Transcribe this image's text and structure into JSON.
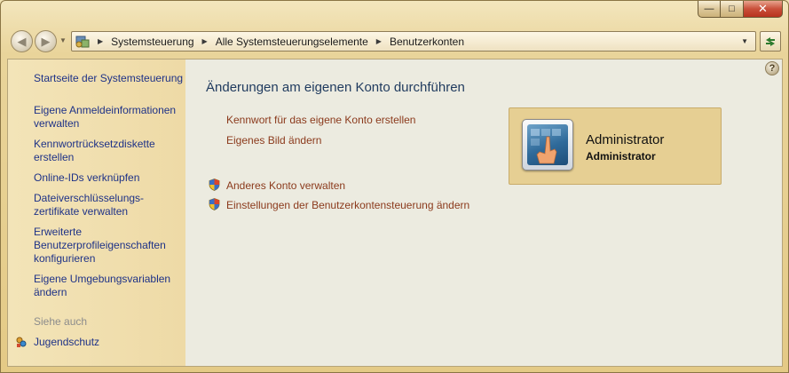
{
  "breadcrumb": [
    "Systemsteuerung",
    "Alle Systemsteuerungselemente",
    "Benutzerkonten"
  ],
  "sidebar": {
    "home_link": "Startseite der Systemsteuerung",
    "links": [
      {
        "line1": "Eigene Anmeldeinformationen",
        "line2": "verwalten"
      },
      {
        "line1": "Kennwortrücksetzdiskette",
        "line2": "erstellen"
      },
      {
        "line1": "Online-IDs verknüpfen",
        "line2": ""
      },
      {
        "line1": "Dateiverschlüsselungs-",
        "line2": "zertifikate verwalten"
      },
      {
        "line1": "Erweiterte",
        "line2": "Benutzerprofileigenschaften",
        "line3": "konfigurieren"
      },
      {
        "line1": "Eigene Umgebungsvariablen",
        "line2": "ändern"
      }
    ],
    "see_also_heading": "Siehe auch",
    "see_also_items": [
      "Jugendschutz"
    ]
  },
  "main": {
    "title": "Änderungen am eigenen Konto durchführen",
    "tasks": [
      "Kennwort für das eigene Konto erstellen",
      "Eigenes Bild ändern"
    ],
    "admin_tasks": [
      "Anderes Konto verwalten",
      "Einstellungen der Benutzerkontensteuerung ändern"
    ]
  },
  "account": {
    "name": "Administrator",
    "role": "Administrator"
  },
  "colors": {
    "link_blue": "#1e3287",
    "task_link": "#8b3a1c",
    "sidebar_bg": "#f3e4b8",
    "card_bg": "#e6cf93"
  }
}
